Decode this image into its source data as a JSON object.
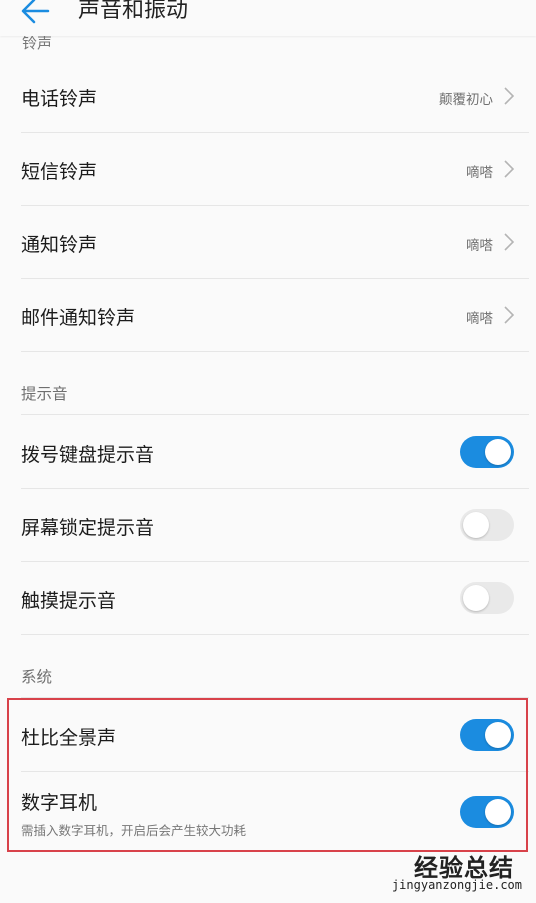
{
  "header": {
    "title": "声音和振动"
  },
  "ringtones": {
    "section_title_cut": "铃声",
    "items": [
      {
        "label": "电话铃声",
        "value": "颠覆初心"
      },
      {
        "label": "短信铃声",
        "value": "嘀嗒"
      },
      {
        "label": "通知铃声",
        "value": "嘀嗒"
      },
      {
        "label": "邮件通知铃声",
        "value": "嘀嗒"
      }
    ]
  },
  "tones": {
    "section_title": "提示音",
    "items": [
      {
        "label": "拨号键盘提示音",
        "enabled": true
      },
      {
        "label": "屏幕锁定提示音",
        "enabled": false
      },
      {
        "label": "触摸提示音",
        "enabled": false
      }
    ]
  },
  "system": {
    "section_title": "系统",
    "items": [
      {
        "label": "杜比全景声",
        "enabled": true
      },
      {
        "label": "数字耳机",
        "sub": "需插入数字耳机，开启后会产生较大功耗",
        "enabled": true
      }
    ]
  },
  "colors": {
    "accent": "#1b8ce0",
    "toggle_off": "#e9e9e9",
    "highlight": "#d8424a"
  },
  "watermark": {
    "main": "经验总结",
    "url": "jingyanzongjie.com"
  }
}
